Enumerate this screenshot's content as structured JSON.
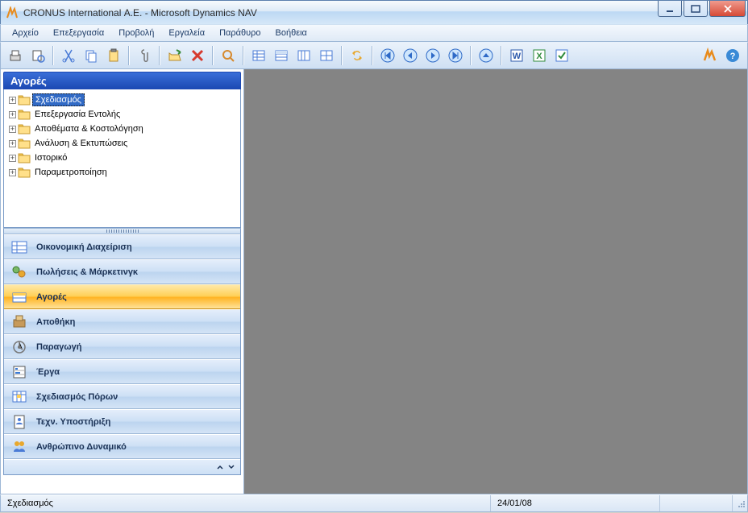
{
  "window": {
    "title": "CRONUS International Α.Ε. - Microsoft Dynamics NAV"
  },
  "menu": [
    "Αρχείο",
    "Επεξεργασία",
    "Προβολή",
    "Εργαλεία",
    "Παράθυρο",
    "Βοήθεια"
  ],
  "sidebar": {
    "header": "Αγορές",
    "tree": [
      {
        "label": "Σχεδιασμός",
        "selected": true
      },
      {
        "label": "Επεξεργασία Εντολής"
      },
      {
        "label": "Αποθέματα & Κοστολόγηση"
      },
      {
        "label": "Ανάλυση & Εκτυπώσεις"
      },
      {
        "label": "Ιστορικό"
      },
      {
        "label": "Παραμετροποίηση"
      }
    ],
    "nav": [
      {
        "label": "Οικονομική Διαχείριση"
      },
      {
        "label": "Πωλήσεις & Μάρκετινγκ"
      },
      {
        "label": "Αγορές",
        "active": true
      },
      {
        "label": "Αποθήκη"
      },
      {
        "label": "Παραγωγή"
      },
      {
        "label": "Έργα"
      },
      {
        "label": "Σχεδιασμός Πόρων"
      },
      {
        "label": "Τεχν. Υποστήριξη"
      },
      {
        "label": "Ανθρώπινο Δυναμικό"
      }
    ]
  },
  "status": {
    "text": "Σχεδιασμός",
    "date": "24/01/08"
  },
  "toolbar_icons": [
    "print-icon",
    "print-preview-icon",
    "sep",
    "cut-icon",
    "copy-icon",
    "paste-icon",
    "sep",
    "attach-icon",
    "sep",
    "open-icon",
    "delete-icon",
    "sep",
    "find-icon",
    "sep",
    "list-icon",
    "list2-icon",
    "list3-icon",
    "list4-icon",
    "sep",
    "refresh-icon",
    "sep",
    "first-icon",
    "prev-icon",
    "next-icon",
    "last-icon",
    "sep",
    "up-icon",
    "sep",
    "word-icon",
    "excel-icon",
    "check-icon"
  ],
  "toolbar_right": [
    "nav-logo-icon",
    "help-icon"
  ],
  "colors": {
    "accent": "#1c49b4",
    "select": "#316ac5",
    "active": "#ffb321"
  }
}
